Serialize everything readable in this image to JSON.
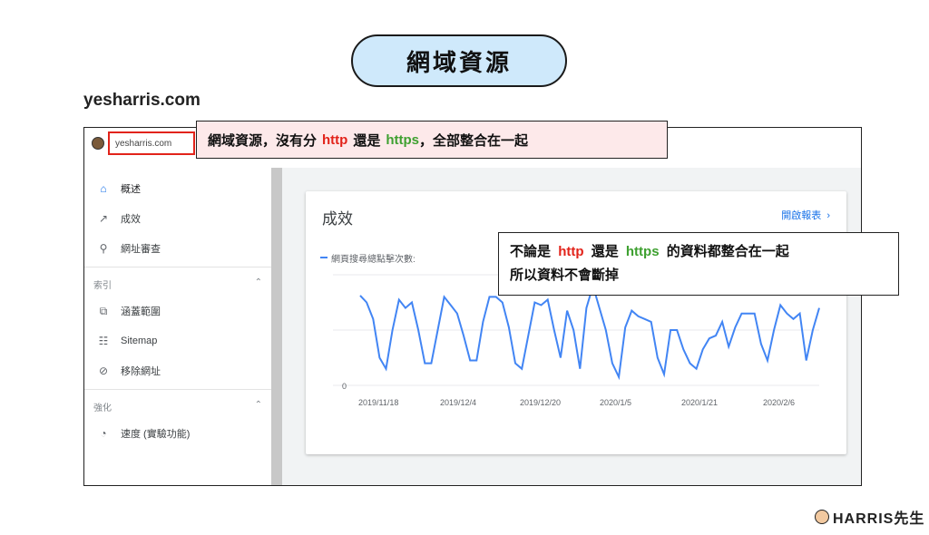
{
  "title": "網域資源",
  "domain_heading": "yesharris.com",
  "topbar": {
    "property_name": "yesharris.com"
  },
  "callout1": {
    "prefix": "網域資源，沒有分",
    "http": "http",
    "middle": "還是",
    "https": "https",
    "suffix": "，全部整合在一起"
  },
  "callout2": {
    "line1_prefix": "不論是",
    "http": "http",
    "middle": "還是",
    "https": "https",
    "line1_suffix": "的資料都整合在一起",
    "line2": "所以資料不會斷掉"
  },
  "sidebar": {
    "items_top": [
      {
        "label": "概述",
        "icon": "home-icon",
        "glyph": "⌂"
      },
      {
        "label": "成效",
        "icon": "trending-up-icon",
        "glyph": "↗"
      },
      {
        "label": "網址審查",
        "icon": "search-icon",
        "glyph": "⚲"
      }
    ],
    "index_section": "索引",
    "items_index": [
      {
        "label": "涵蓋範圍",
        "icon": "coverage-icon",
        "glyph": "⧉"
      },
      {
        "label": "Sitemap",
        "icon": "sitemap-icon",
        "glyph": "☷"
      },
      {
        "label": "移除網址",
        "icon": "removal-icon",
        "glyph": "⊘"
      }
    ],
    "enhance_section": "強化",
    "items_enhance": [
      {
        "label": "速度 (實驗功能)",
        "icon": "speed-icon",
        "glyph": "◔"
      }
    ]
  },
  "card": {
    "title": "成效",
    "link": "開啟報表",
    "legend": "網頁搜尋總點擊次數:"
  },
  "colors": {
    "line": "#4285f4",
    "accent": "#1a73e8",
    "red": "#e2231a",
    "green": "#3ea030"
  },
  "chart_data": {
    "type": "line",
    "x_tick_labels": [
      "2019/11/18",
      "2019/12/4",
      "2019/12/20",
      "2020/1/5",
      "2020/1/21",
      "2020/2/6"
    ],
    "y_tick_labels": [
      "0"
    ],
    "series": [
      {
        "values": [
          65,
          60,
          48,
          20,
          12,
          40,
          62,
          56,
          60,
          40,
          16,
          16,
          40,
          64,
          58,
          52,
          36,
          18,
          18,
          46,
          64,
          64,
          60,
          42,
          16,
          12,
          36,
          60,
          58,
          62,
          40,
          20,
          54,
          40,
          12,
          56,
          72,
          56,
          40,
          16,
          6,
          42,
          54,
          50,
          48,
          46,
          20,
          8,
          40,
          40,
          26,
          16,
          12,
          26,
          34,
          36,
          46,
          28,
          42,
          52,
          52,
          52,
          30,
          18,
          40,
          58,
          52,
          48,
          52,
          18,
          40,
          56
        ]
      }
    ]
  },
  "logo": {
    "text": "HARRIS先生"
  }
}
